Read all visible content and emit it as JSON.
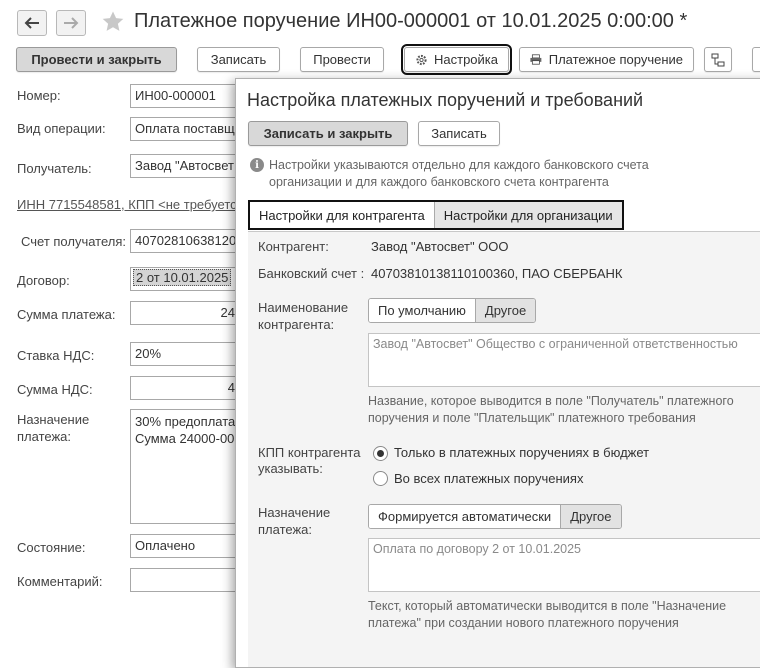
{
  "window": {
    "title": "Платежное поручение ИН00-000001 от 10.01.2025 0:00:00 *"
  },
  "toolbar": {
    "post_close": "Провести и закрыть",
    "save": "Записать",
    "post": "Провести",
    "settings": "Настройка",
    "print_payment_order": "Платежное поручение"
  },
  "form": {
    "number_label": "Номер:",
    "number_value": "ИН00-000001",
    "operation_label": "Вид операции:",
    "operation_value": "Оплата поставщ",
    "recipient_label": "Получатель:",
    "recipient_value": "Завод \"Автосвет",
    "inn_link": "ИНН 7715548581, КПП <не требуется",
    "account_label": "Счет получателя:",
    "account_value": "40702810638120",
    "contract_label": "Договор:",
    "contract_value": "2 от 10.01.2025",
    "amount_label": "Сумма платежа:",
    "amount_value": "24",
    "vat_rate_label": "Ставка НДС:",
    "vat_rate_value": "20%",
    "vat_amount_label": "Сумма НДС:",
    "vat_amount_value": "4",
    "purpose_label_1": "Назначение",
    "purpose_label_2": "платежа:",
    "purpose_line_1": "30% предоплата",
    "purpose_line_2": "Сумма 24000-00,",
    "state_label": "Состояние:",
    "state_value": "Оплачено",
    "comment_label": "Комментарий:",
    "comment_value": ""
  },
  "dialog": {
    "title": "Настройка платежных поручений и требований",
    "save_close": "Записать и закрыть",
    "save": "Записать",
    "hint_line_1": "Настройки указываются отдельно для каждого банковского счета",
    "hint_line_2": "организации и для каждого банковского счета контрагента",
    "tabs": [
      {
        "label": "Настройки для контрагента"
      },
      {
        "label": "Настройки для организации"
      }
    ],
    "counterparty_label": "Контрагент:",
    "counterparty_value": "Завод \"Автосвет\" ООО",
    "bank_account_label": "Банковский счет :",
    "bank_account_value": "40703810138110100360, ПАО СБЕРБАНК",
    "name_label_1": "Наименование",
    "name_label_2": "контрагента:",
    "name_opt_default": "По умолчанию",
    "name_opt_other": "Другое",
    "name_text": "Завод \"Автосвет\" Общество с ограниченной ответственностью",
    "name_hint_1": "Название, которое выводится в поле \"Получатель\" платежного",
    "name_hint_2": "поручения и поле \"Плательщик\" платежного требования",
    "kpp_label_1": "КПП контрагента",
    "kpp_label_2": "указывать:",
    "kpp_opt_budget": "Только в платежных поручениях в бюджет",
    "kpp_opt_all": "Во всех платежных поручениях",
    "purpose_label_1": "Назначение",
    "purpose_label_2": "платежа:",
    "purpose_opt_auto": "Формируется автоматически",
    "purpose_opt_other": "Другое",
    "purpose_text": "Оплата по договору 2 от 10.01.2025",
    "purpose_hint_1": "Текст, который автоматически выводится в поле \"Назначение",
    "purpose_hint_2": "платежа\" при создании нового платежного поручения"
  }
}
